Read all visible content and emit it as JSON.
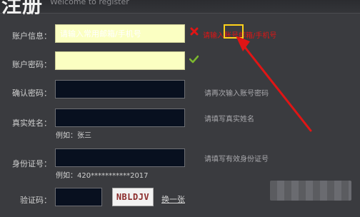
{
  "header": {
    "title": "注册",
    "subtitle": "Welcome to register"
  },
  "form": {
    "account": {
      "label": "账户信息：",
      "value": "请输入常用邮箱/手机号",
      "error": "请输入账号邮箱/手机号"
    },
    "password": {
      "label": "账户密码："
    },
    "confirm": {
      "label": "确认密码：",
      "hint": "请再次输入账号密码"
    },
    "real_name": {
      "label": "真实姓名：",
      "hint": "请填写真实姓名",
      "example": "例如：张三"
    },
    "id_number": {
      "label": "身份证号：",
      "hint": "请填写有效身份证号",
      "example": "例如：420***********2017"
    },
    "captcha": {
      "label": "验证码：",
      "image_text": "NBLDJV",
      "refresh": "换一张"
    }
  },
  "icons": {
    "error": "cross-icon",
    "ok": "check-icon"
  },
  "colors": {
    "error": "#e01515",
    "ok": "#7cb82f",
    "annotation": "#ffd21a",
    "arrow": "#e01515"
  }
}
